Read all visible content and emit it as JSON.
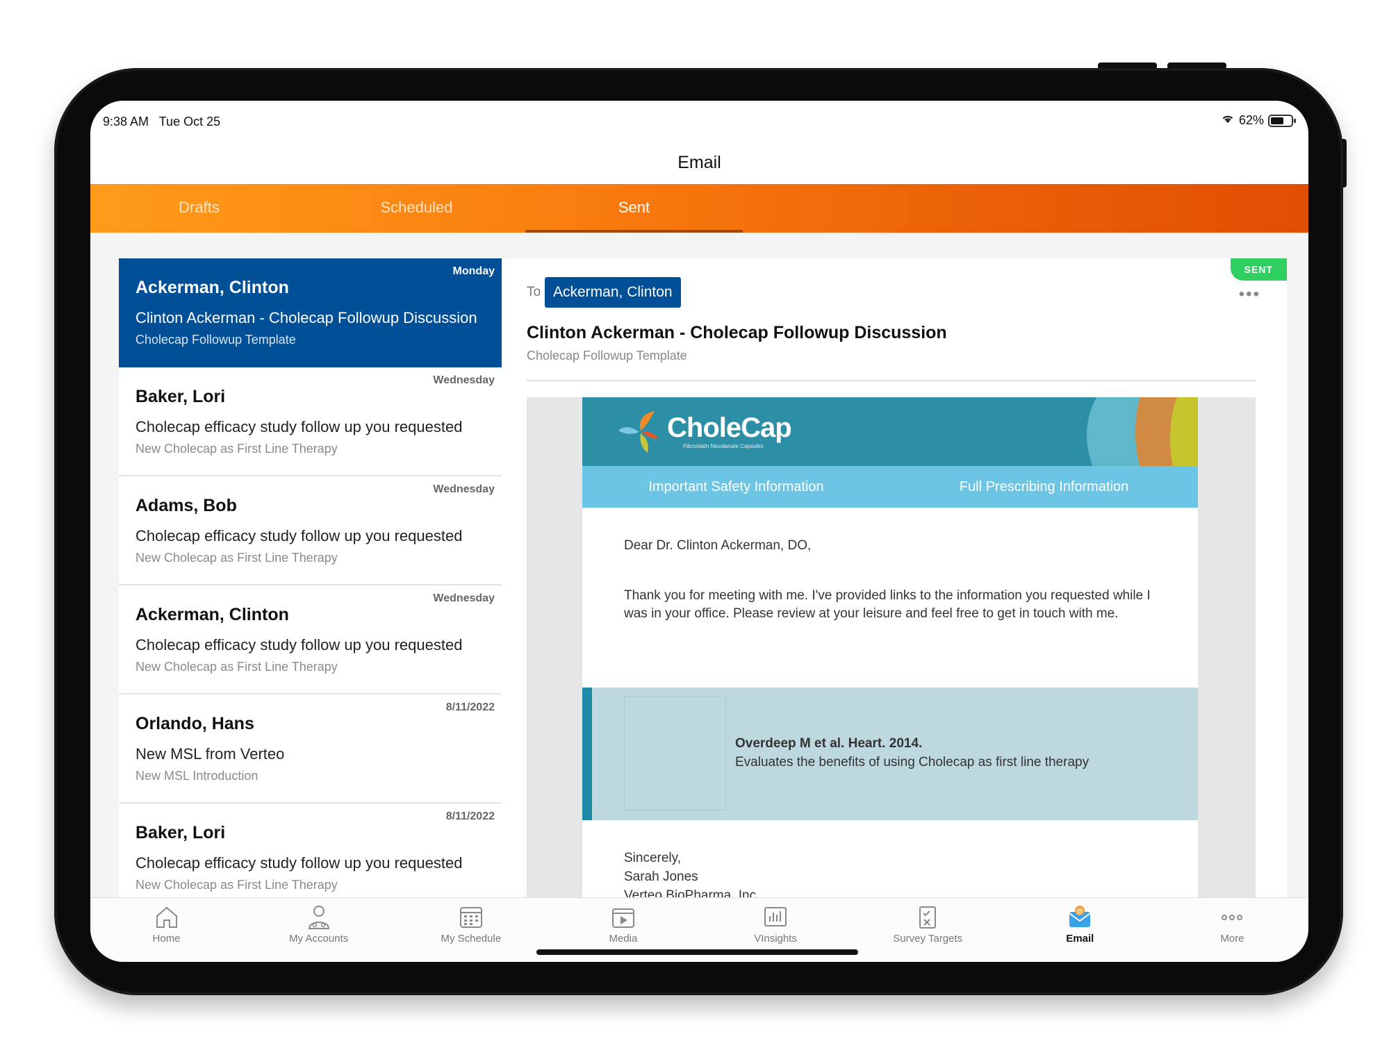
{
  "status_bar": {
    "time": "9:38 AM",
    "date": "Tue Oct 25",
    "battery": "62%"
  },
  "header": {
    "title": "Email"
  },
  "tabs": [
    {
      "label": "Drafts",
      "active": false
    },
    {
      "label": "Scheduled",
      "active": false
    },
    {
      "label": "Sent",
      "active": true
    }
  ],
  "emails": [
    {
      "name": "Ackerman, Clinton",
      "day": "Monday",
      "subject": "Clinton Ackerman - Cholecap Followup Discussion",
      "template": "Cholecap Followup Template",
      "selected": true
    },
    {
      "name": "Baker, Lori",
      "day": "Wednesday",
      "subject": "Cholecap efficacy study follow up you requested",
      "template": "New Cholecap as First Line Therapy",
      "selected": false
    },
    {
      "name": "Adams, Bob",
      "day": "Wednesday",
      "subject": "Cholecap efficacy study follow up you requested",
      "template": "New Cholecap as First Line Therapy",
      "selected": false
    },
    {
      "name": "Ackerman, Clinton",
      "day": "Wednesday",
      "subject": "Cholecap efficacy study follow up you requested",
      "template": "New Cholecap as First Line Therapy",
      "selected": false
    },
    {
      "name": "Orlando, Hans",
      "day": "8/11/2022",
      "subject": "New MSL from Verteo",
      "template": "New MSL Introduction",
      "selected": false
    },
    {
      "name": "Baker, Lori",
      "day": "8/11/2022",
      "subject": "Cholecap efficacy study follow up you requested",
      "template": "New Cholecap as First Line Therapy",
      "selected": false
    }
  ],
  "detail": {
    "badge": "SENT",
    "to_label": "To",
    "recipient": "Ackerman, Clinton",
    "more": "•••",
    "subject": "Clinton Ackerman - Cholecap Followup Discussion",
    "template": "Cholecap Followup Template",
    "brand_name": "CholeCap",
    "brand_sub": "Fibrostatin Nicodanate Capsules",
    "links": {
      "safety": "Important Safety Information",
      "prescribing": "Full Prescribing Information"
    },
    "greeting": "Dear Dr. Clinton Ackerman, DO,",
    "body": "Thank you for meeting with me. I've provided links to the information you requested while I was in your office. Please review at your leisure and feel free to get in touch with me.",
    "ref_title": "Overdeep M et al. Heart. 2014.",
    "ref_desc": "Evaluates the benefits of using Cholecap as first line therapy",
    "closing": [
      "Sincerely,",
      "Sarah Jones",
      "Verteo BioPharma, Inc."
    ]
  },
  "bottom_nav": [
    {
      "label": "Home",
      "icon": "home-icon",
      "active": false
    },
    {
      "label": "My Accounts",
      "icon": "accounts-icon",
      "active": false
    },
    {
      "label": "My Schedule",
      "icon": "calendar-icon",
      "active": false
    },
    {
      "label": "Media",
      "icon": "media-icon",
      "active": false
    },
    {
      "label": "VInsights",
      "icon": "insights-icon",
      "active": false
    },
    {
      "label": "Survey Targets",
      "icon": "survey-icon",
      "active": false
    },
    {
      "label": "Email",
      "icon": "email-icon",
      "active": true
    },
    {
      "label": "More",
      "icon": "more-icon",
      "active": false
    }
  ],
  "colors": {
    "accent_blue": "#004f97",
    "tab_orange_start": "#ff9b1a",
    "tab_orange_end": "#e04e03",
    "sent_green": "#2fcf62",
    "brand_teal": "#2c8fa6",
    "link_bar": "#6cc5e4"
  }
}
